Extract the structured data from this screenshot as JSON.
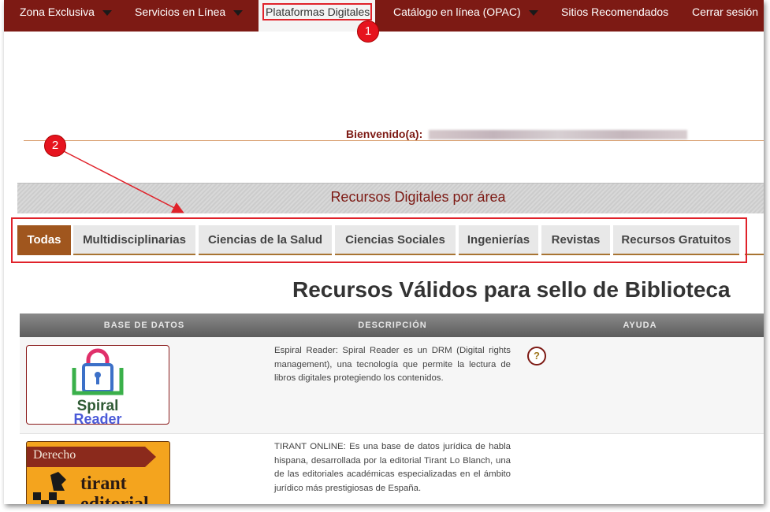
{
  "nav": {
    "items": [
      {
        "label": "Zona Exclusiva",
        "has_dropdown": true
      },
      {
        "label": "Servicios en Línea",
        "has_dropdown": true
      },
      {
        "label": "Plataformas Digitales",
        "has_dropdown": false,
        "active": true
      },
      {
        "label": "Catálogo en línea (OPAC)",
        "has_dropdown": true
      },
      {
        "label": "Sitios Recomendados",
        "has_dropdown": false
      },
      {
        "label": "Cerrar sesión",
        "has_dropdown": false
      }
    ]
  },
  "annotations": {
    "marker_1": "1",
    "marker_2": "2",
    "highlight_color": "#e0222a"
  },
  "welcome": {
    "label": "Bienvenido(a):"
  },
  "banner": {
    "title": "Recursos Digitales por área"
  },
  "tabs": [
    {
      "label": "Todas",
      "active": true
    },
    {
      "label": "Multidisciplinarias"
    },
    {
      "label": "Ciencias de la Salud"
    },
    {
      "label": "Ciencias Sociales"
    },
    {
      "label": "Ingenierías"
    },
    {
      "label": "Revistas"
    },
    {
      "label": "Recursos Gratuitos"
    }
  ],
  "main": {
    "heading": "Recursos Válidos para sello de Biblioteca",
    "columns": [
      "BASE DE DATOS",
      "DESCRIPCIÓN",
      "AYUDA"
    ],
    "rows": [
      {
        "logo_line1": "Spiral",
        "logo_line2": "Reader",
        "description": "Espiral Reader: Spiral Reader es un DRM (Digital rights management), una tecnología que permite la lectura de libros digitales protegiendo los contenidos.",
        "help": "?"
      },
      {
        "logo_category": "Derecho",
        "logo_line1": "tirant",
        "logo_line2": "editorial",
        "description": "TIRANT ONLINE: Es una base de datos jurídica de habla hispana, desarrollada por la editorial Tirant Lo Blanch, una de las editoriales académicas especializadas en el ámbito jurídico más prestigiosas de España."
      }
    ]
  },
  "colors": {
    "brand": "#7d1a14",
    "tab_active": "#a0561e",
    "tab_accent": "#a87432"
  }
}
